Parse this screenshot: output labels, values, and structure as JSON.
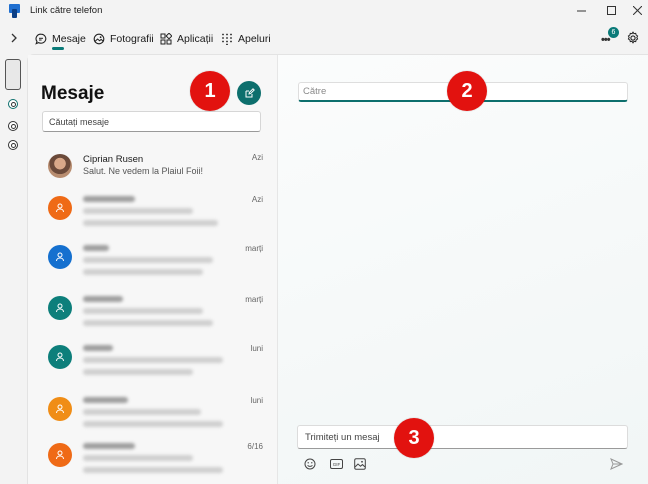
{
  "app": {
    "title": "Link către telefon",
    "accent": "#0d6f6d"
  },
  "nav": {
    "tabs": [
      {
        "label": "Mesaje",
        "icon": "chat-bubble-icon",
        "active": true
      },
      {
        "label": "Fotografii",
        "icon": "photos-icon"
      },
      {
        "label": "Aplicații",
        "icon": "apps-grid-icon"
      },
      {
        "label": "Apeluri",
        "icon": "dialpad-icon"
      }
    ],
    "notifications": {
      "count": "6",
      "icon": "more-dots-icon"
    }
  },
  "messages_panel": {
    "heading": "Mesaje",
    "search_placeholder": "Căutați mesaje",
    "conversations": [
      {
        "name": "Ciprian Rusen",
        "preview": "Salut. Ne vedem la Plaiul Foii!",
        "date": "Azi",
        "avatar_color": "#8a6a55"
      },
      {
        "name": "",
        "preview": "",
        "date": "Azi",
        "avatar_color": "#ef6a16",
        "blurred": true
      },
      {
        "name": "",
        "preview": "",
        "date": "marți",
        "avatar_color": "#1570cf",
        "blurred": true
      },
      {
        "name": "",
        "preview": "",
        "date": "marți",
        "avatar_color": "#0d7f7b",
        "blurred": true
      },
      {
        "name": "",
        "preview": "",
        "date": "luni",
        "avatar_color": "#0d7f7b",
        "blurred": true
      },
      {
        "name": "",
        "preview": "",
        "date": "luni",
        "avatar_color": "#f08d16",
        "blurred": true
      },
      {
        "name": "",
        "preview": "",
        "date": "6/16",
        "avatar_color": "#ef6a16",
        "blurred": true
      }
    ]
  },
  "compose_panel": {
    "to_placeholder": "Către",
    "message_placeholder": "Trimiteți un mesaj",
    "tools": [
      "emoji-icon",
      "gif-icon",
      "image-icon"
    ],
    "send_icon": "send-icon"
  },
  "markers": [
    "1",
    "2",
    "3"
  ]
}
